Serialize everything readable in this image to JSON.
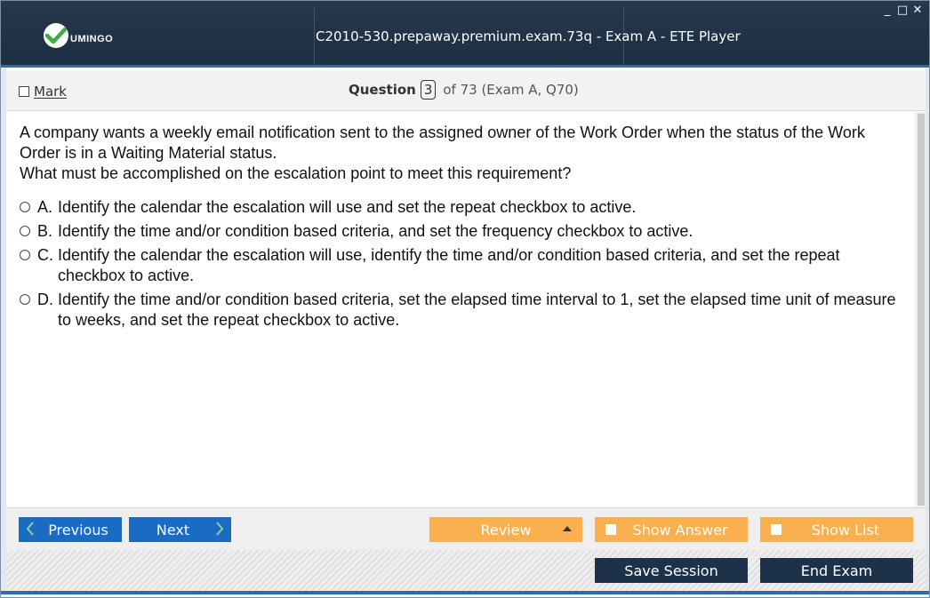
{
  "window": {
    "brand": "UMINGO",
    "title": "C2010-530.prepaway.premium.exam.73q - Exam A - ETE Player",
    "controls": {
      "minimize": "_",
      "maximize": "□",
      "close": "✕"
    }
  },
  "header": {
    "mark_label": "Mark",
    "question_label": "Question",
    "question_number": "3",
    "question_of": "of 73 (Exam A, Q70)"
  },
  "question": {
    "text_line1": "A company wants a weekly email notification sent to the assigned owner of the Work Order when the status of the Work Order is in a Waiting Material status.",
    "text_line2": "What must be accomplished on the escalation point to meet this requirement?",
    "options": [
      {
        "letter": "A.",
        "text": "Identify the calendar the escalation will use and set the repeat checkbox to active."
      },
      {
        "letter": "B.",
        "text": "Identify the time and/or condition based criteria, and set the frequency checkbox to active."
      },
      {
        "letter": "C.",
        "text": "Identify the calendar the escalation will use, identify the time and/or condition based criteria, and set the repeat checkbox to active."
      },
      {
        "letter": "D.",
        "text": "Identify the time and/or condition based criteria, set the elapsed time interval to 1, set the elapsed time unit of measure to weeks, and set the repeat checkbox to active."
      }
    ]
  },
  "zoom": {
    "icons": [
      "search-icon",
      "zoom-in-icon",
      "zoom-out-icon"
    ]
  },
  "nav": {
    "previous_label": "Previous",
    "next_label": "Next",
    "review_label": "Review",
    "show_answer_label": "Show Answer",
    "show_list_label": "Show List"
  },
  "footer": {
    "save_label": "Save Session",
    "end_label": "End Exam"
  },
  "colors": {
    "titlebar": "#1d2f42",
    "accent_blue": "#1a6bc4",
    "orange": "#fbb050",
    "dark_button": "#1d3149"
  }
}
